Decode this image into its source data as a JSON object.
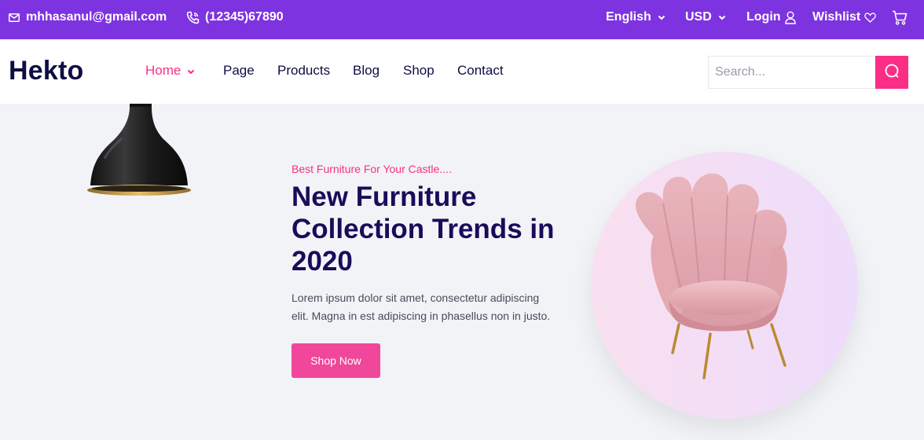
{
  "topbar": {
    "email": "mhhasanul@gmail.com",
    "phone": "(12345)67890",
    "language": "English",
    "currency": "USD",
    "login": "Login",
    "wishlist": "Wishlist"
  },
  "header": {
    "logo": "Hekto",
    "nav": [
      "Home",
      "Page",
      "Products",
      "Blog",
      "Shop",
      "Contact"
    ],
    "search_placeholder": "Search..."
  },
  "hero": {
    "tagline": "Best Furniture For Your Castle....",
    "headline": "New Furniture Collection Trends in 2020",
    "description": "Lorem ipsum dolor sit amet, consectetur adipiscing elit. Magna in est adipiscing in phasellus non in justo.",
    "cta": "Shop Now"
  },
  "colors": {
    "topbar": "#7e33e0",
    "accent": "#fb2e86",
    "heading": "#1a0b5b"
  }
}
